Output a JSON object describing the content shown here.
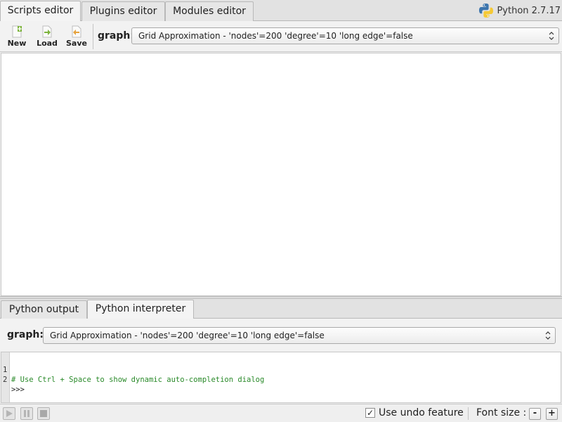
{
  "top_tabs": [
    {
      "label": "Scripts editor",
      "active": true
    },
    {
      "label": "Plugins editor",
      "active": false
    },
    {
      "label": "Modules editor",
      "active": false
    }
  ],
  "python_version": "Python 2.7.17",
  "toolbar": {
    "new_label": "New",
    "load_label": "Load",
    "save_label": "Save",
    "graph_label": "graph:",
    "graph_value": "Grid Approximation - 'nodes'=200 'degree'=10 'long edge'=false"
  },
  "bottom_tabs": [
    {
      "label": "Python output",
      "active": false
    },
    {
      "label": "Python interpreter",
      "active": true
    }
  ],
  "interpreter": {
    "graph_label": "graph:",
    "graph_value": "Grid Approximation - 'nodes'=200 'degree'=10 'long edge'=false"
  },
  "console": {
    "lines": [
      {
        "num": "1",
        "text": "# Use Ctrl + Space to show dynamic auto-completion dialog"
      },
      {
        "num": "2",
        "text": ">>>"
      }
    ]
  },
  "statusbar": {
    "undo_label": "Use undo feature",
    "undo_checked": "✓",
    "font_size_label": "Font size :",
    "decrease_label": "-",
    "increase_label": "+"
  },
  "colors": {
    "comment": "#2a8a2a",
    "new_icon": "#7db33d",
    "load_icon": "#7db33d",
    "save_icon": "#e6a23c",
    "python_blue": "#3b74ad",
    "python_yellow": "#f5c935"
  },
  "icons": [
    "new-file-icon",
    "load-file-icon",
    "save-file-icon",
    "python-logo-icon",
    "play-icon",
    "pause-icon",
    "stop-icon",
    "chevron-updown-icon"
  ]
}
